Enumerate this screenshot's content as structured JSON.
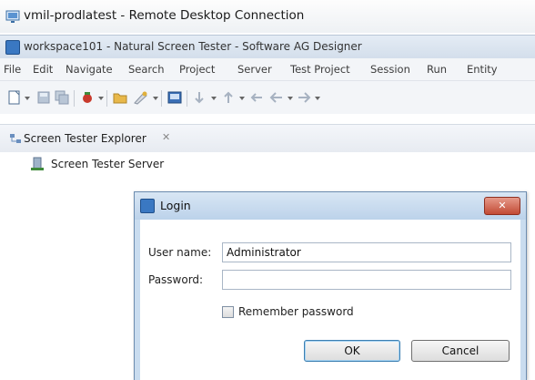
{
  "rdp": {
    "title": "vmil-prodlatest - Remote Desktop Connection"
  },
  "window": {
    "title": "workspace101 - Natural Screen Tester - Software AG Designer"
  },
  "menu": {
    "items": [
      "File",
      "Edit",
      "Navigate",
      "Search",
      "Project",
      "Server",
      "Test Project",
      "Session",
      "Run",
      "Entity"
    ]
  },
  "toolbar": {
    "icons": [
      "new-icon",
      "save-icon",
      "save-all-icon",
      "debug-icon",
      "open-folder-icon",
      "run-icon",
      "console-icon",
      "next-annotation-icon",
      "prev-annotation-icon",
      "back-icon",
      "forward-icon"
    ]
  },
  "explorer": {
    "tab_label": "Screen Tester Explorer",
    "close_glyph": "✕",
    "tree": [
      {
        "label": "Screen Tester Server"
      }
    ]
  },
  "login": {
    "title": "Login",
    "close_glyph": "✕",
    "username_label": "User name:",
    "username_value": "Administrator",
    "password_label": "Password:",
    "password_value": "",
    "remember_label": "Remember password",
    "remember_checked": false,
    "ok_label": "OK",
    "cancel_label": "Cancel"
  },
  "colors": {
    "dialog_frame": "#c9dcef",
    "close_button": "#c24a34",
    "default_button_border": "#3c7fb1"
  }
}
